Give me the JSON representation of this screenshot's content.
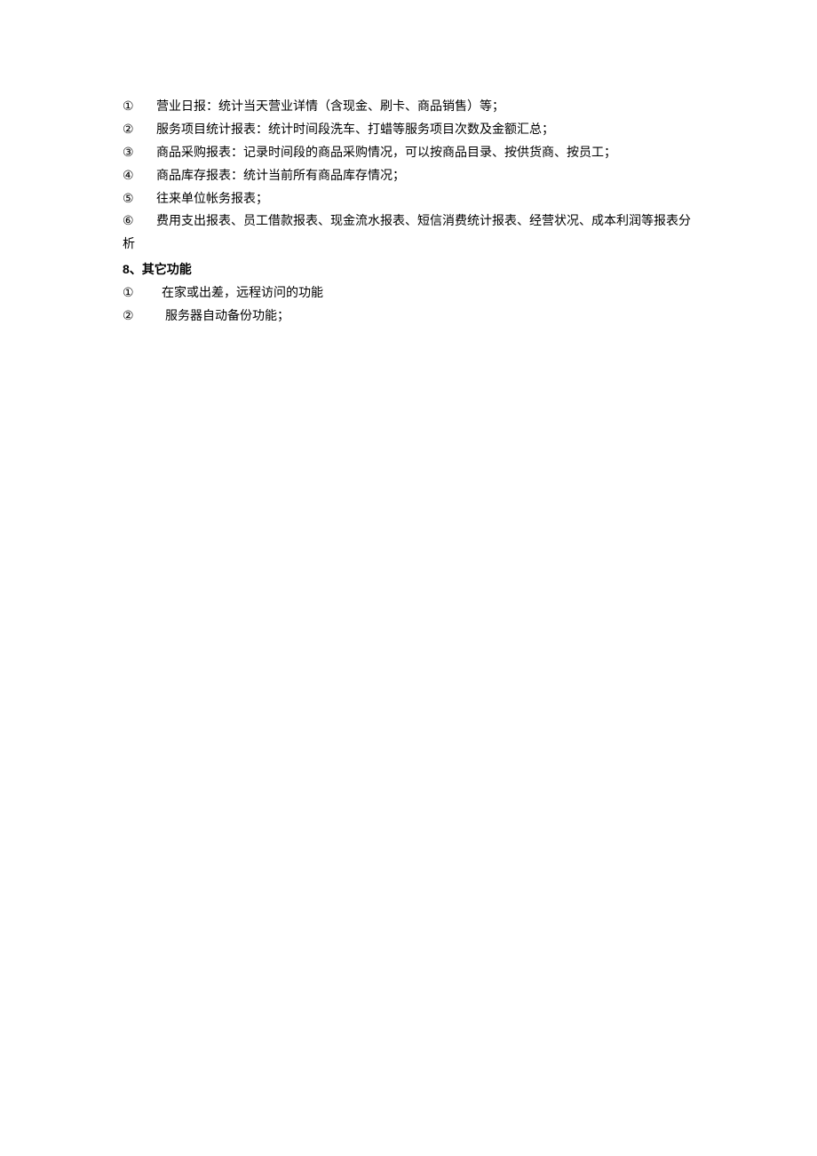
{
  "section1": {
    "items": [
      {
        "marker": "①",
        "text": "营业日报：统计当天营业详情（含现金、刷卡、商品销售）等；"
      },
      {
        "marker": "②",
        "text": "服务项目统计报表：统计时间段洗车、打蜡等服务项目次数及金额汇总；"
      },
      {
        "marker": "③",
        "text": "商品采购报表：记录时间段的商品采购情况，可以按商品目录、按供货商、按员工；"
      },
      {
        "marker": "④",
        "text": "商品库存报表：统计当前所有商品库存情况；"
      },
      {
        "marker": "⑤",
        "text": "往来单位帐务报表；"
      },
      {
        "marker": "⑥",
        "text": "费用支出报表、员工借款报表、现金流水报表、短信消费统计报表、经营状况、成本利润等报表分"
      }
    ],
    "continuation": "析"
  },
  "heading": {
    "number": "8",
    "separator": "、",
    "title": "其它功能"
  },
  "section2": {
    "items": [
      {
        "marker": "①",
        "text": "在家或出差，远程访问的功能"
      },
      {
        "marker": "②",
        "text": "服务器自动备份功能；"
      }
    ]
  }
}
